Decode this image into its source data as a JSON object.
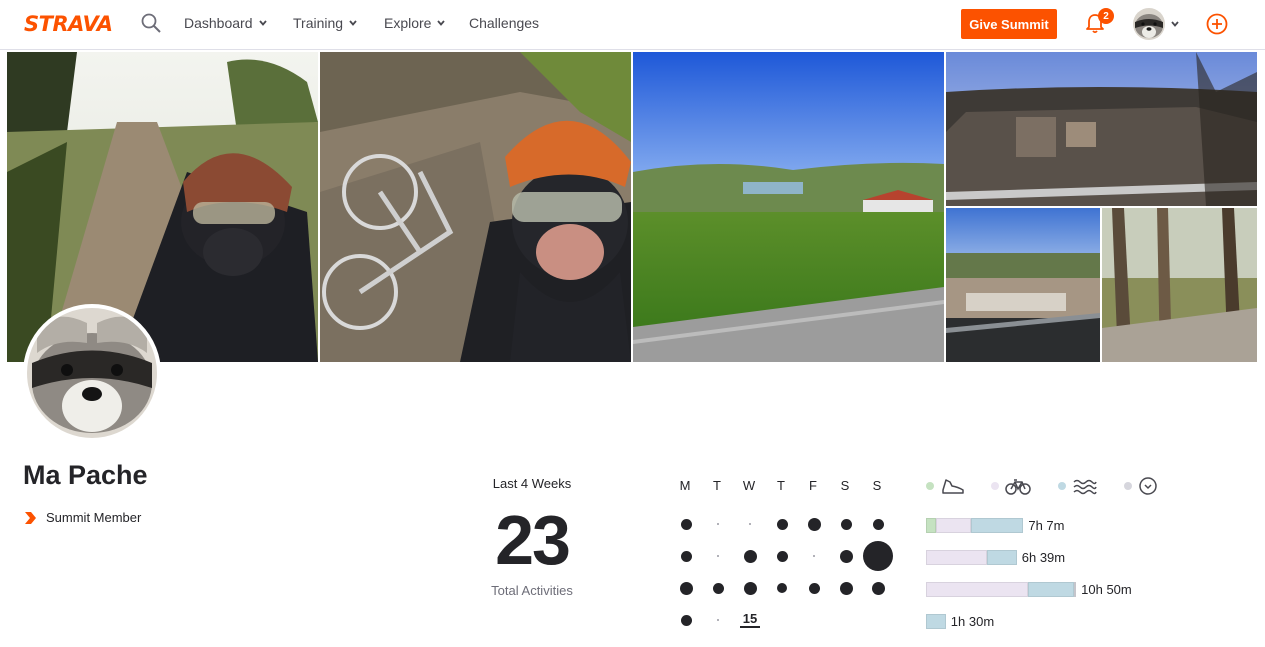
{
  "brand": {
    "logo_text": "STRAVA",
    "accent": "#fc5200"
  },
  "nav": {
    "items": [
      {
        "label": "Dashboard",
        "has_menu": true
      },
      {
        "label": "Training",
        "has_menu": true
      },
      {
        "label": "Explore",
        "has_menu": true
      },
      {
        "label": "Challenges",
        "has_menu": false
      }
    ],
    "cta_label": "Give Summit",
    "notification_count": "2",
    "icons": [
      "search-icon",
      "bell-icon",
      "avatar",
      "chevron-down-icon",
      "plus-circle-icon"
    ]
  },
  "banner": {
    "photos": [
      "trail-selfie",
      "bike-selfie",
      "valley-view",
      "town-overlook",
      "river-town",
      "forest-path"
    ]
  },
  "profile": {
    "name": "Ma Pache",
    "membership": "Summit Member"
  },
  "stats": {
    "period_label": "Last 4 Weeks",
    "total_activities": "23",
    "total_caption": "Total Activities",
    "today_label": "15",
    "weekday_labels": [
      "M",
      "T",
      "W",
      "T",
      "F",
      "S",
      "S"
    ],
    "calendar_levels": [
      [
        2,
        0,
        0,
        2,
        3,
        2,
        2
      ],
      [
        2,
        0,
        3,
        2,
        0,
        3,
        5
      ],
      [
        3,
        2,
        3,
        1,
        2,
        3,
        3
      ],
      [
        2,
        0
      ]
    ]
  },
  "sports": [
    {
      "name": "run",
      "icon": "shoe-icon",
      "color": "#c5e2c1"
    },
    {
      "name": "ride",
      "icon": "bike-icon",
      "color": "#ebe4f1"
    },
    {
      "name": "swim",
      "icon": "waves-icon",
      "color": "#bfd9e3"
    },
    {
      "name": "other",
      "icon": "stopwatch-icon",
      "color": "#d6d6dd"
    }
  ],
  "weekly_totals": [
    {
      "time": "7h 7m",
      "segments": [
        {
          "sport": "run",
          "hours": 0.6
        },
        {
          "sport": "ride",
          "hours": 2.1
        },
        {
          "sport": "swim",
          "hours": 3.2
        }
      ]
    },
    {
      "time": "6h 39m",
      "segments": [
        {
          "sport": "ride",
          "hours": 3.7
        },
        {
          "sport": "swim",
          "hours": 1.8
        }
      ]
    },
    {
      "time": "10h 50m",
      "segments": [
        {
          "sport": "ride",
          "hours": 6.2
        },
        {
          "sport": "swim",
          "hours": 2.8
        },
        {
          "sport": "other",
          "hours": 0.1
        }
      ]
    },
    {
      "time": "1h 30m",
      "segments": [
        {
          "sport": "swim",
          "hours": 1.2
        }
      ]
    }
  ]
}
